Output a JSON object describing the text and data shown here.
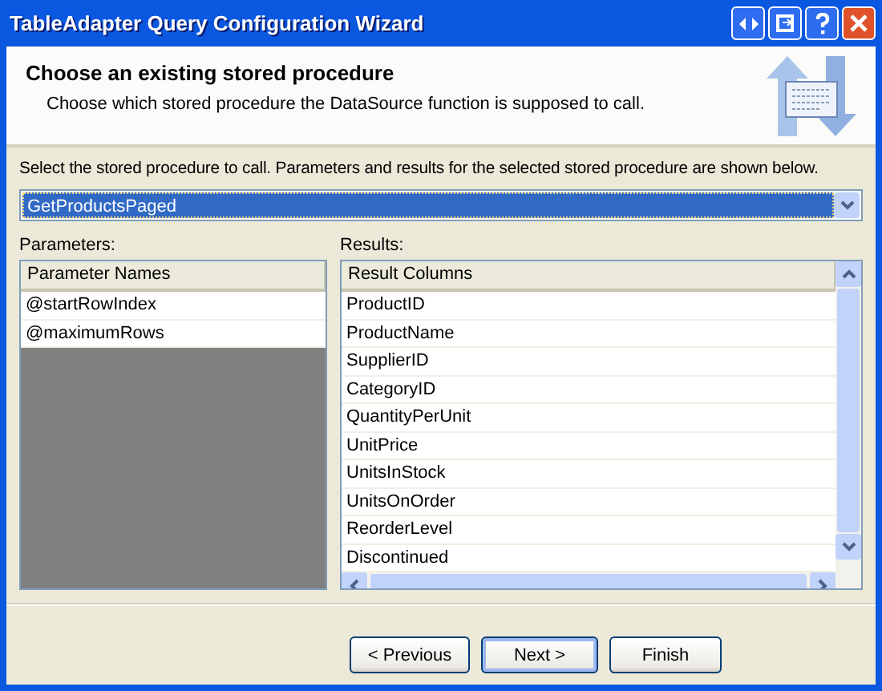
{
  "window": {
    "title": "TableAdapter Query Configuration Wizard"
  },
  "header": {
    "title": "Choose an existing stored procedure",
    "subtitle": "Choose which stored procedure the DataSource function is supposed to call."
  },
  "prompt": "Select the stored procedure to call. Parameters and results for the selected stored procedure are shown below.",
  "procedure_select": {
    "value": "GetProductsPaged"
  },
  "parameters": {
    "label": "Parameters:",
    "column": "Parameter Names",
    "rows": [
      "@startRowIndex",
      "@maximumRows"
    ]
  },
  "results": {
    "label": "Results:",
    "column": "Result Columns",
    "rows": [
      "ProductID",
      "ProductName",
      "SupplierID",
      "CategoryID",
      "QuantityPerUnit",
      "UnitPrice",
      "UnitsInStock",
      "UnitsOnOrder",
      "ReorderLevel",
      "Discontinued"
    ]
  },
  "buttons": [
    {
      "label": "< Previous",
      "default": false
    },
    {
      "label": "Next >",
      "default": true
    },
    {
      "label": "Finish",
      "default": false
    }
  ]
}
